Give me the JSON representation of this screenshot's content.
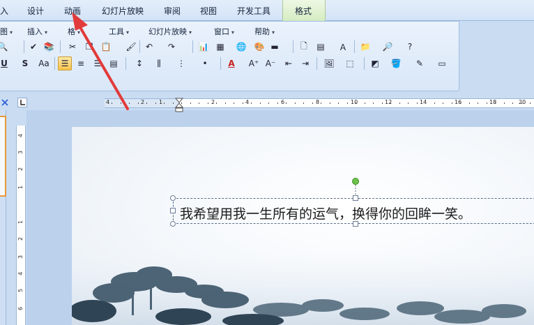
{
  "tabs": [
    "入",
    "设计",
    "动画",
    "幻灯片放映",
    "审阅",
    "视图",
    "开发工具",
    "格式"
  ],
  "menus": [
    "图",
    "插入",
    "格",
    "工具",
    "幻灯片放映",
    "窗口",
    "帮助"
  ],
  "toolbar": {
    "underline_label": "U",
    "shadow_label": "S",
    "case_label": "Aa",
    "font_color_label": "A"
  },
  "ruler_numbers": [
    "4",
    "2",
    "1",
    "2",
    "4",
    "6",
    "8",
    "10",
    "12",
    "14",
    "16",
    "18",
    "20"
  ],
  "vruler_numbers": [
    "4",
    "3",
    "2",
    "1",
    "1",
    "2",
    "3",
    "4",
    "5",
    "6"
  ],
  "slide": {
    "text": "我希望用我一生所有的运气，换得你的回眸一笑。"
  },
  "colors": {
    "accent_arrow": "#e23b3b",
    "active_button": "#f7c24c",
    "rotate_handle": "#6cc24a"
  }
}
